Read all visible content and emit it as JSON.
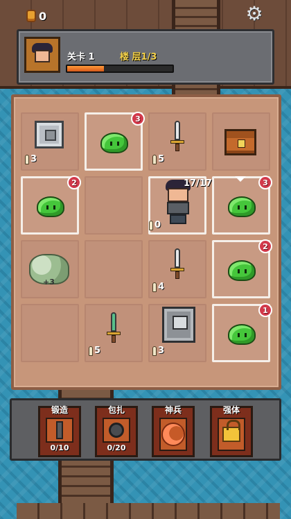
{
  "topbar": {
    "coins": "0"
  },
  "header": {
    "level": "关卡 1",
    "floor": "楼 层1/3",
    "progress": 0.35
  },
  "board": {
    "badges": [
      "3",
      "2",
      "3",
      "2",
      "1"
    ],
    "stats": [
      "3",
      "5",
      "0",
      "4",
      "5",
      "3"
    ],
    "rock_label": "+3",
    "hero_hp": "17/17"
  },
  "actions": [
    {
      "label": "锻造",
      "count": "0/10"
    },
    {
      "label": "包扎",
      "count": "0/20"
    },
    {
      "label": "神兵",
      "count": ""
    },
    {
      "label": "强体",
      "count": ""
    }
  ],
  "colors": {
    "slime": "#45c63b",
    "badge": "#d2394b",
    "progress": "#e06a20"
  }
}
